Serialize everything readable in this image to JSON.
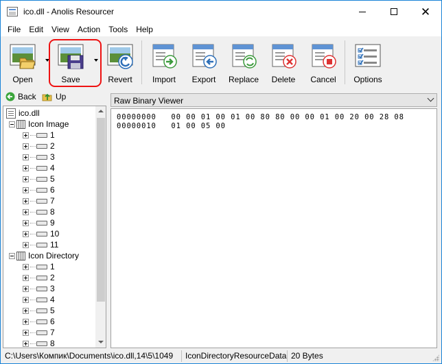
{
  "window": {
    "title": "ico.dll - Anolis Resourcer",
    "controls": {
      "minimize": "minimize",
      "maximize": "maximize",
      "close": "close"
    }
  },
  "menu": [
    "File",
    "Edit",
    "View",
    "Action",
    "Tools",
    "Help"
  ],
  "toolbar": {
    "buttons": [
      {
        "label": "Open",
        "icon": "open-folder-icon"
      },
      {
        "label": "Save",
        "icon": "save-disk-icon"
      },
      {
        "label": "Revert",
        "icon": "revert-icon"
      },
      {
        "label": "Import",
        "icon": "import-icon"
      },
      {
        "label": "Export",
        "icon": "export-icon"
      },
      {
        "label": "Replace",
        "icon": "replace-icon"
      },
      {
        "label": "Delete",
        "icon": "delete-icon"
      },
      {
        "label": "Cancel",
        "icon": "cancel-icon"
      },
      {
        "label": "Options",
        "icon": "options-icon"
      }
    ]
  },
  "nav": {
    "back": "Back",
    "up": "Up"
  },
  "tree": {
    "root": "ico.dll",
    "groups": [
      {
        "label": "Icon Image",
        "items": [
          "1",
          "2",
          "3",
          "4",
          "5",
          "6",
          "7",
          "8",
          "9",
          "10",
          "11"
        ]
      },
      {
        "label": "Icon Directory",
        "items": [
          "1",
          "2",
          "3",
          "4",
          "5",
          "6",
          "7",
          "8"
        ]
      }
    ]
  },
  "viewer": {
    "selected": "Raw Binary Viewer",
    "lines": [
      "00000000   00 00 01 00 01 00 80 80 00 00 01 00 20 00 28 08",
      "00000010   01 00 05 00"
    ]
  },
  "status": {
    "path": "C:\\Users\\Компик\\Documents\\ico.dll,14\\5\\1049",
    "type": "IconDirectoryResourceData",
    "size": "20 Bytes"
  },
  "colors": {
    "accent": "#1883d7",
    "highlight": "#ee1111"
  }
}
